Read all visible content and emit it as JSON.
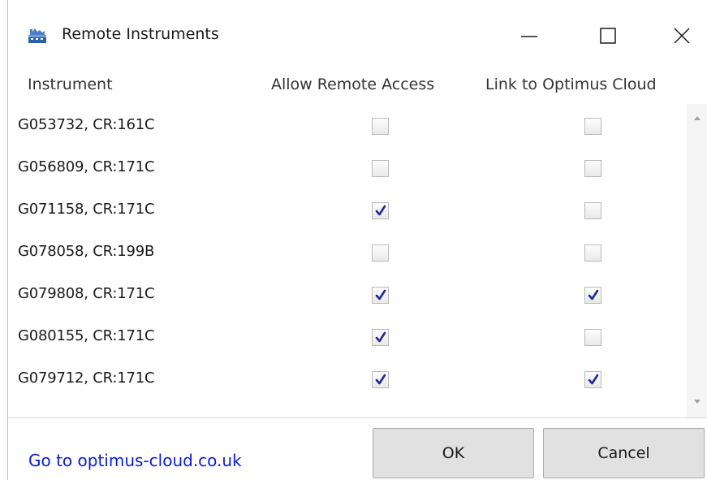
{
  "window": {
    "title": "Remote Instruments",
    "app_icon": "instrument-app-icon",
    "controls": [
      "minimize-icon",
      "maximize-icon",
      "close-icon"
    ]
  },
  "columns": {
    "instrument": "Instrument",
    "remote_access": "Allow Remote Access",
    "cloud_link": "Link to Optimus Cloud"
  },
  "rows": [
    {
      "instrument": "G053732, CR:161C",
      "remote_access": false,
      "cloud_link": false
    },
    {
      "instrument": "G056809, CR:171C",
      "remote_access": false,
      "cloud_link": false
    },
    {
      "instrument": "G071158, CR:171C",
      "remote_access": true,
      "cloud_link": false
    },
    {
      "instrument": "G078058, CR:199B",
      "remote_access": false,
      "cloud_link": false
    },
    {
      "instrument": "G079808, CR:171C",
      "remote_access": true,
      "cloud_link": true
    },
    {
      "instrument": "G080155, CR:171C",
      "remote_access": true,
      "cloud_link": false
    },
    {
      "instrument": "G079712, CR:171C",
      "remote_access": true,
      "cloud_link": true
    }
  ],
  "footer": {
    "link_text": "Go to optimus-cloud.co.uk",
    "ok_label": "OK",
    "cancel_label": "Cancel"
  },
  "colors": {
    "link": "#0a1bd8",
    "check": "#1f2a8c"
  }
}
